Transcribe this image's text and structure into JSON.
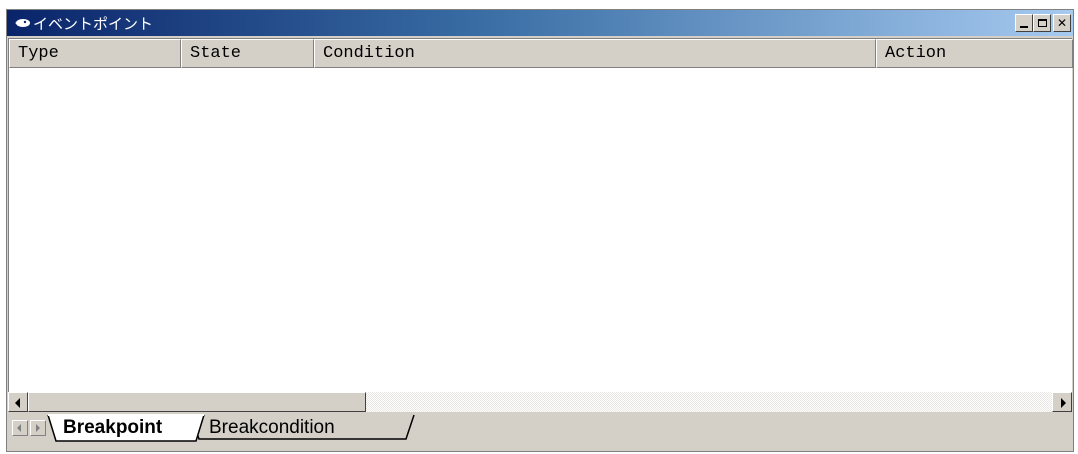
{
  "window": {
    "title": "イベントポイント",
    "controls": {
      "minimize_icon": "minimize-icon",
      "maximize_icon": "maximize-icon",
      "close_label": "✕"
    }
  },
  "table": {
    "columns": [
      {
        "label": "Type"
      },
      {
        "label": "State"
      },
      {
        "label": "Condition"
      },
      {
        "label": "Action"
      }
    ],
    "rows": []
  },
  "tabs": {
    "items": [
      {
        "label": "Breakpoint",
        "active": true
      },
      {
        "label": "Breakcondition",
        "active": false
      }
    ]
  },
  "colors": {
    "titlebar_start": "#0a246a",
    "titlebar_end": "#a6caf0",
    "face": "#d4d0c8"
  }
}
